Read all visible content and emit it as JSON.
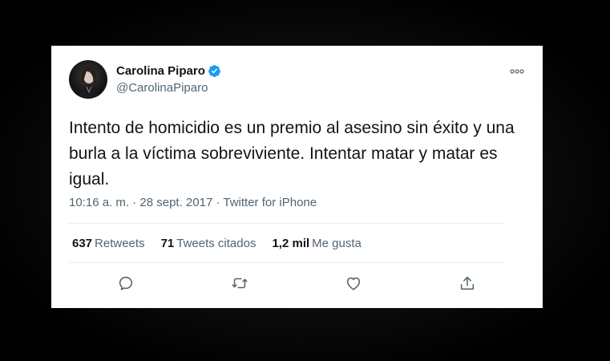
{
  "tweet": {
    "author": {
      "name": "Carolina Piparo",
      "handle": "@CarolinaPiparo",
      "verified": true
    },
    "text": "Intento de homicidio es un premio al asesino sin éxito y una burla a la víctima sobreviviente. Intentar matar y matar es igual.",
    "timestamp": "10:16 a. m. · 28 sept. 2017",
    "source": "Twitter for iPhone",
    "stats": {
      "retweets_count": "637",
      "retweets_label": "Retweets",
      "quotes_count": "71",
      "quotes_label": "Tweets citados",
      "likes_count": "1,2 mil",
      "likes_label": "Me gusta"
    }
  },
  "colors": {
    "background": "#000000",
    "card": "#ffffff",
    "text": "#0f1419",
    "muted": "#536471",
    "verified_blue": "#1d9bf0"
  },
  "icons": {
    "more": "more-dots-icon",
    "reply": "reply-icon",
    "retweet": "retweet-icon",
    "like": "heart-icon",
    "share": "share-icon",
    "verified": "verified-badge-icon"
  }
}
